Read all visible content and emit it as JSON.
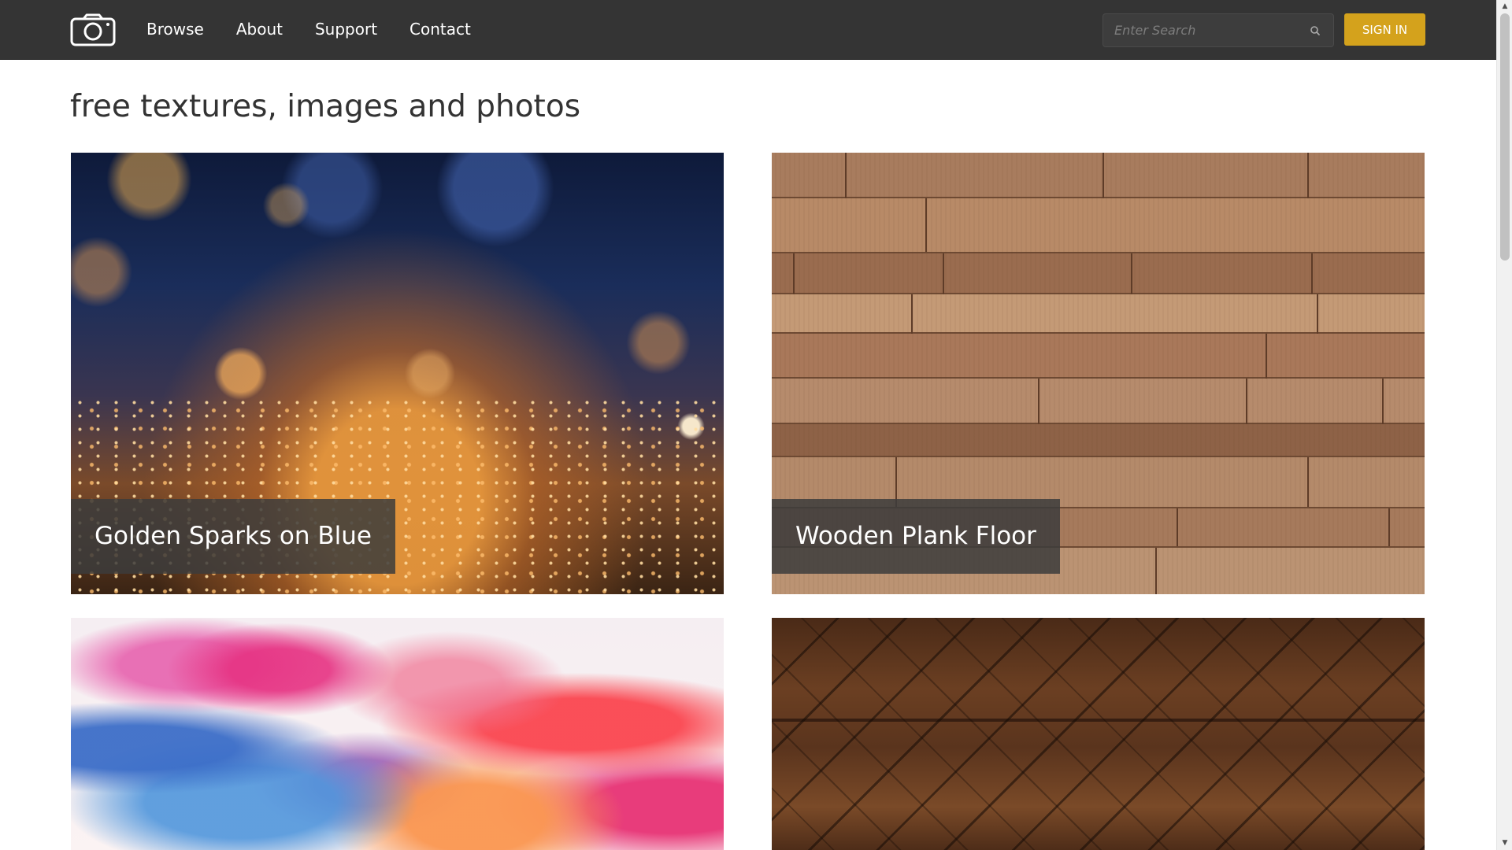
{
  "navbar": {
    "logo_icon": "camera-icon",
    "links": [
      {
        "label": "Browse"
      },
      {
        "label": "About"
      },
      {
        "label": "Support"
      },
      {
        "label": "Contact"
      }
    ],
    "search": {
      "placeholder": "Enter Search",
      "value": "",
      "icon": "search-icon"
    },
    "signin_label": "SIGN IN"
  },
  "colors": {
    "navbar_bg": "#343434",
    "accent": "#d4a21c",
    "caption_bg": "#3c3c3c"
  },
  "page": {
    "title": "free textures, images and photos"
  },
  "gallery": [
    {
      "caption": "Golden Sparks on Blue"
    },
    {
      "caption": "Wooden Plank Floor"
    },
    {
      "caption": ""
    },
    {
      "caption": ""
    }
  ]
}
